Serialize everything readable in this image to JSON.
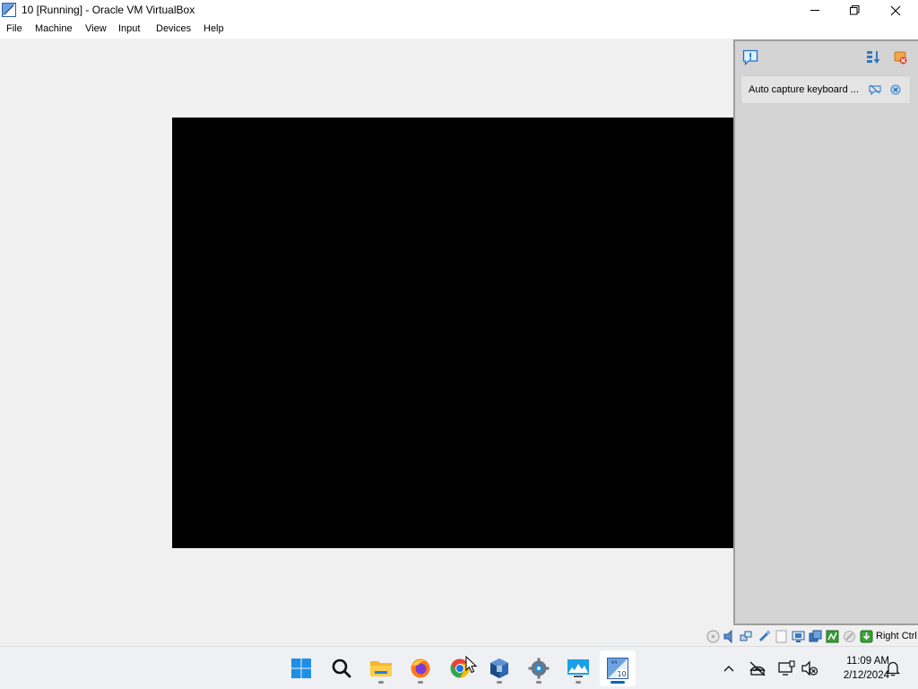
{
  "window": {
    "title": "10 [Running] - Oracle VM VirtualBox"
  },
  "menubar": {
    "items": [
      "File",
      "Machine",
      "View",
      "Input",
      "Devices",
      "Help"
    ]
  },
  "notification_center": {
    "icons": {
      "info": "info-icon",
      "sort": "sort-icon",
      "clear_all": "clear-all-icon"
    },
    "items": [
      {
        "text": "Auto capture keyboard ...",
        "hide_icon": "hide-icon",
        "close_icon": "close-icon"
      }
    ]
  },
  "statusbar": {
    "indicators": [
      "optical-drive-icon",
      "audio-icon",
      "network-icon",
      "usb-icon",
      "shared-folders-icon",
      "display-icon",
      "recording-icon",
      "cpu-activity-icon",
      "mouse-integration-icon",
      "keyboard-icon"
    ],
    "host_key_label": "Right Ctrl"
  },
  "taskbar": {
    "apps": [
      "start-icon",
      "search-icon",
      "file-explorer-icon",
      "firefox-icon",
      "chrome-icon",
      "virtualbox-icon",
      "settings-icon",
      "task-manager-icon",
      "virtualbox-vm-icon"
    ],
    "active_app": "virtualbox-vm-icon",
    "tray": [
      "show-hidden-icons-icon",
      "network-off-icon",
      "display-icon",
      "volume-muted-icon",
      "notification-bell-icon"
    ],
    "clock": {
      "time": "11:09 AM",
      "date": "2/12/2024"
    }
  },
  "colors": {
    "accent": "#0067c0",
    "vm_screen": "#000000",
    "notify_pane": "#d4d4d4"
  }
}
